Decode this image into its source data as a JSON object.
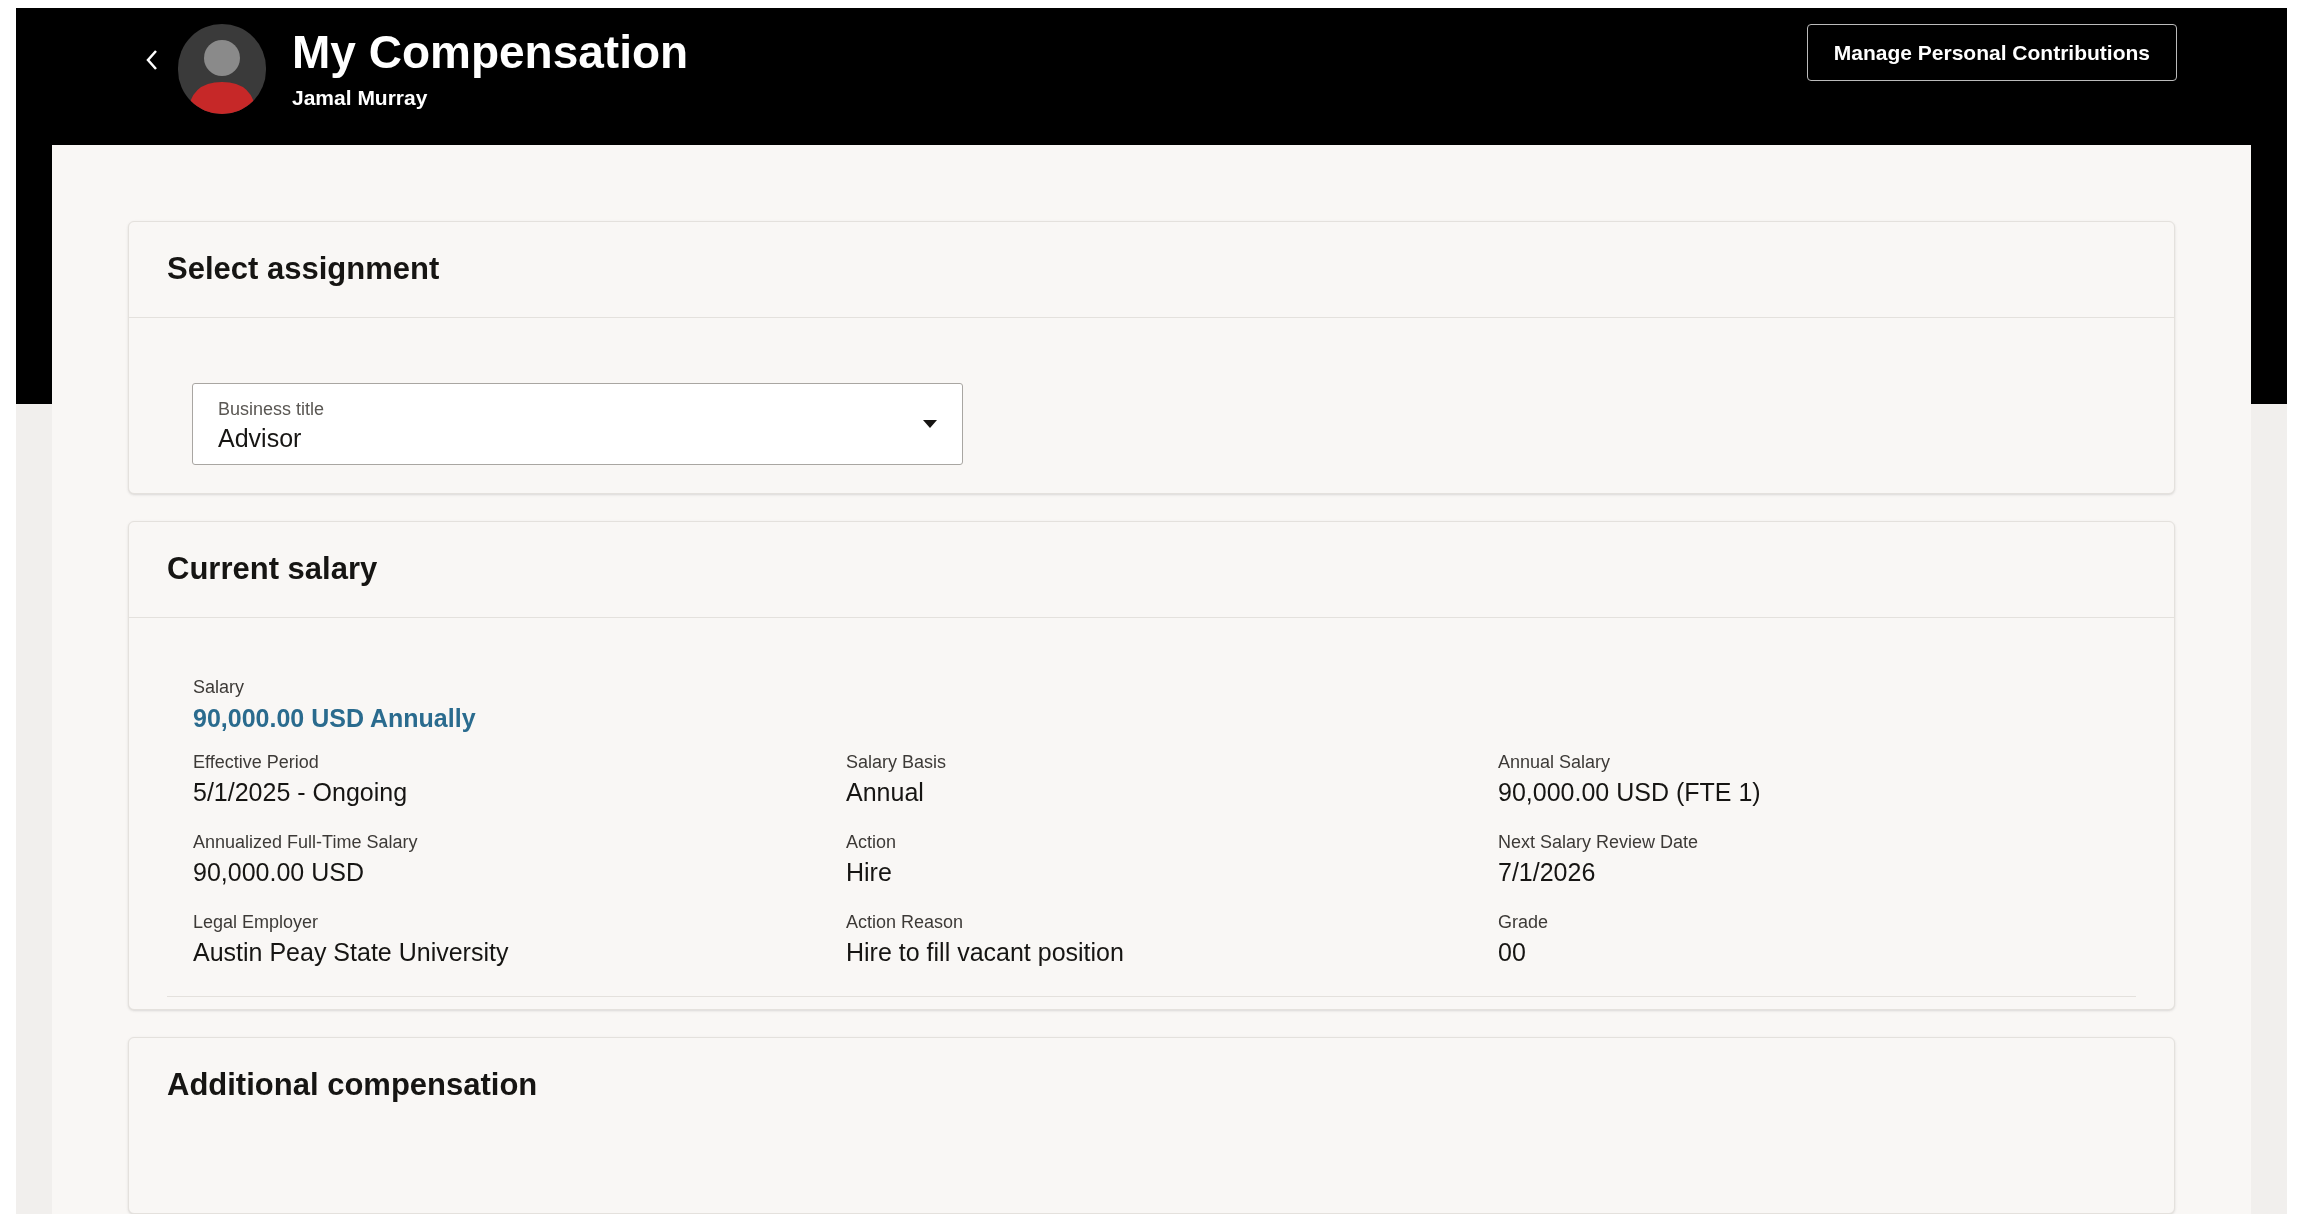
{
  "header": {
    "title": "My Compensation",
    "name": "Jamal Murray",
    "action_button": "Manage Personal Contributions"
  },
  "assignment": {
    "title": "Select assignment",
    "field": {
      "label": "Business title",
      "value": "Advisor"
    }
  },
  "current_salary": {
    "title": "Current salary",
    "salary": {
      "label": "Salary",
      "value": "90,000.00 USD Annually"
    },
    "fields": [
      {
        "label": "Effective Period",
        "value": "5/1/2025 - Ongoing"
      },
      {
        "label": "Salary Basis",
        "value": "Annual"
      },
      {
        "label": "Annual Salary",
        "value": "90,000.00 USD (FTE 1)"
      },
      {
        "label": "Annualized Full-Time Salary",
        "value": "90,000.00 USD"
      },
      {
        "label": "Action",
        "value": "Hire"
      },
      {
        "label": "Next Salary Review Date",
        "value": "7/1/2026"
      },
      {
        "label": "Legal Employer",
        "value": "Austin Peay State University"
      },
      {
        "label": "Action Reason",
        "value": "Hire to fill vacant position"
      },
      {
        "label": "Grade",
        "value": "00"
      }
    ]
  },
  "additional": {
    "title": "Additional compensation"
  }
}
